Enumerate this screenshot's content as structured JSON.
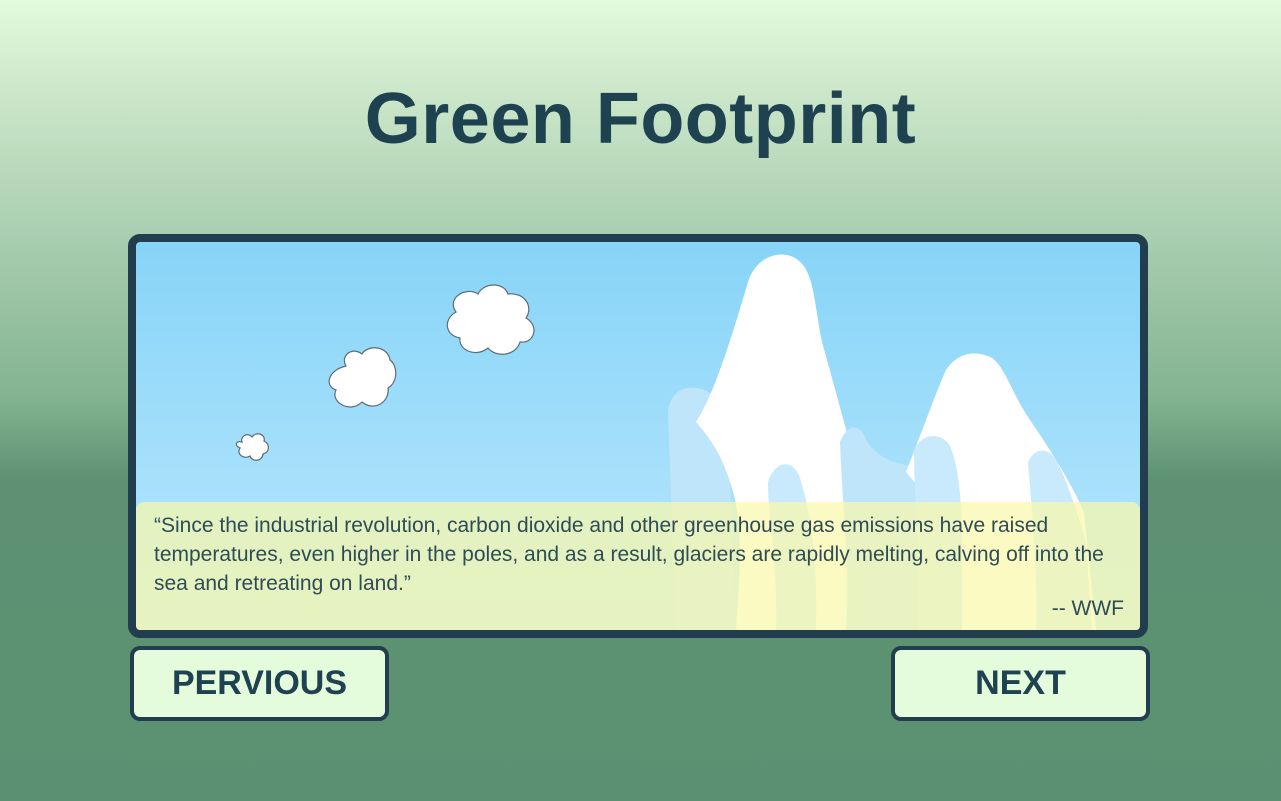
{
  "title": "Green Footprint",
  "quote": {
    "text": "“Since the industrial revolution, carbon dioxide and other greenhouse gas emissions have raised temperatures, even higher in the poles, and as a result, glaciers are rapidly melting, calving off into the sea and retreating on land.”",
    "source": "-- WWF"
  },
  "buttons": {
    "previous": "PERVIOUS",
    "next": "NEXT"
  },
  "colors": {
    "title": "#1f4251",
    "frame_border": "#223d4d",
    "sky": "#87d4f8",
    "quote_bg": "#faf8aa",
    "button_bg": "#e4fcdc"
  },
  "scene": {
    "icons": [
      "cloud-icon",
      "glacier-icon"
    ]
  }
}
